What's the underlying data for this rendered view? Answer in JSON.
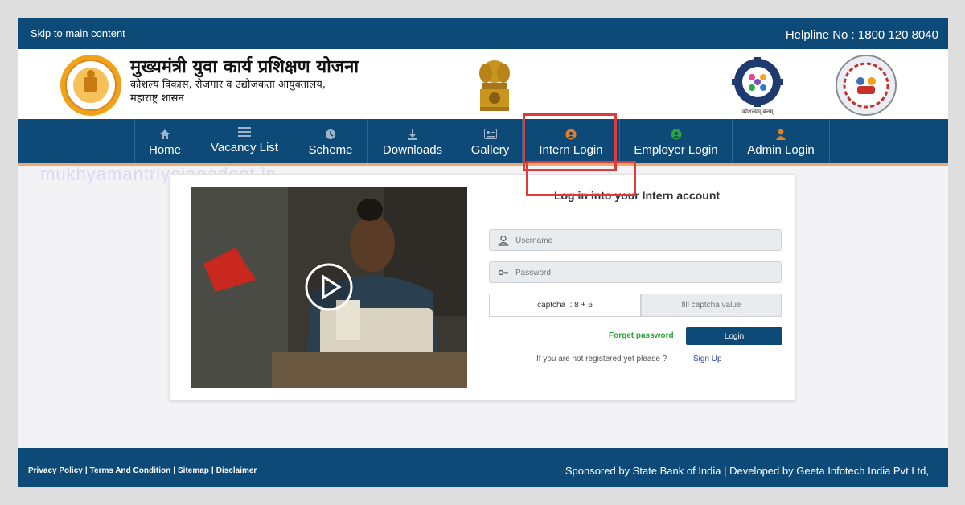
{
  "topbar": {
    "skip_link": "Skip to main content",
    "helpline": "Helpline No : 1800 120 8040"
  },
  "header": {
    "title": "मुख्यमंत्री युवा कार्य प्रशिक्षण योजना",
    "subtitle_line1": "कौशल्य विकास, रोजगार व उद्योजकता आयुक्तालय,",
    "subtitle_line2": "महाराष्ट्र शासन",
    "skill_logo_caption": "कौशल्यम् बलम्"
  },
  "nav": {
    "items": [
      {
        "label": "Home",
        "icon": "home-icon"
      },
      {
        "label": "Vacancy List",
        "icon": "list-icon"
      },
      {
        "label": "Scheme",
        "icon": "scheme-icon"
      },
      {
        "label": "Downloads",
        "icon": "download-icon"
      },
      {
        "label": "Gallery",
        "icon": "gallery-icon"
      },
      {
        "label": "Intern Login",
        "icon": "user-circle-icon"
      },
      {
        "label": "Employer Login",
        "icon": "user-circle-icon"
      },
      {
        "label": "Admin Login",
        "icon": "user-icon"
      }
    ]
  },
  "watermark": "mukhyamantriyojanadoot.in",
  "login": {
    "title": "Log in into your Intern account",
    "username_placeholder": "Username",
    "password_placeholder": "Password",
    "captcha_text": "captcha :: 8 + 6",
    "captcha_placeholder": "fill captcha value",
    "forget_password": "Forget password",
    "login_button": "Login",
    "register_prompt": "If you are not registered yet please ?",
    "signup_link": "Sign Up"
  },
  "footer": {
    "links": [
      "Privacy Policy",
      "Terms And Condition",
      "Sitemap",
      "Disclaimer"
    ],
    "sponsor": "Sponsored by State Bank of India | Developed by Geeta Infotech India Pvt Ltd,"
  },
  "colors": {
    "primary": "#0e4a78",
    "highlight": "#e03a3a",
    "accent_orange": "#e67e22",
    "accent_green": "#2fa33c"
  }
}
